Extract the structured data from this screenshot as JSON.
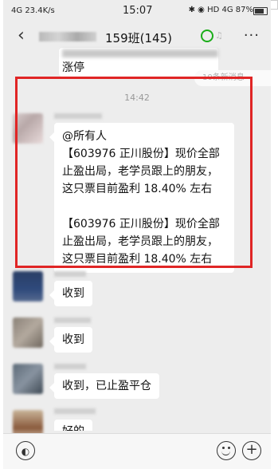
{
  "status": {
    "network": "4G",
    "speed": "23.4K/s",
    "time": "15:07",
    "signal_text": "HD 4G",
    "battery": "87%"
  },
  "header": {
    "title": "159班(145)"
  },
  "top_message": {
    "text": "涨停"
  },
  "unread_pill": "10条新消息",
  "timestamp": "14:42",
  "main_message": {
    "mention": "@所有人",
    "para1": "【603976 正川股份】现价全部止盈出局，老学员跟上的朋友，这只票目前盈利 18.40% 左右",
    "para2": "【603976 正川股份】现价全部止盈出局，老学员跟上的朋友，这只票目前盈利 18.40% 左右"
  },
  "replies": [
    "收到",
    "收到",
    "收到，已止盈平仓",
    "好的"
  ],
  "icons": [
    "back-icon",
    "more-icon",
    "voice-icon",
    "emoji-icon",
    "plus-icon"
  ]
}
